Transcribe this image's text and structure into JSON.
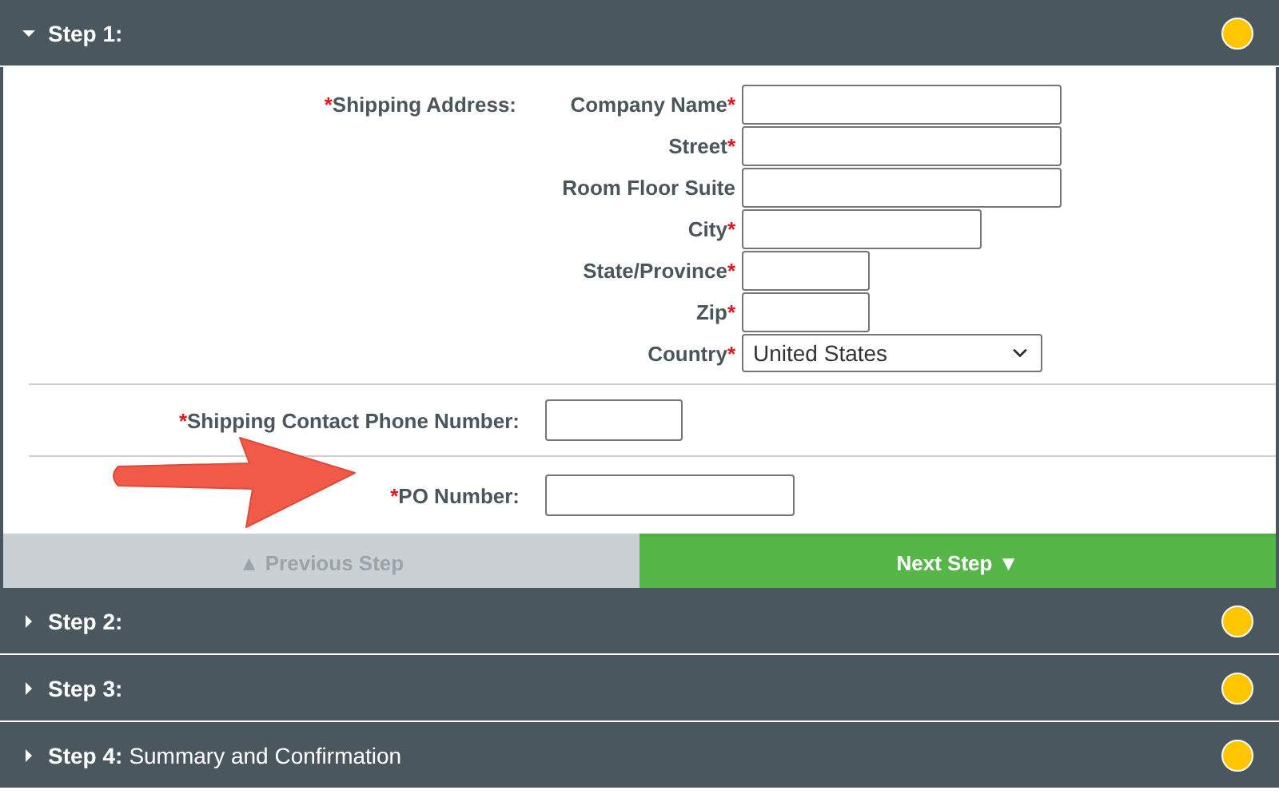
{
  "steps": [
    {
      "title": "Step 1:",
      "expanded": true,
      "color": "#ffc600"
    },
    {
      "title": "Step 2:",
      "expanded": false,
      "color": "#ffc600"
    },
    {
      "title": "Step 3:",
      "expanded": false,
      "color": "#ffc600"
    },
    {
      "title": "Step 4:",
      "subtitle": "Summary and Confirmation",
      "expanded": false,
      "color": "#ffc600"
    }
  ],
  "shipping_address": {
    "label": "Shipping Address:",
    "required": "*",
    "fields": [
      {
        "label": "Company Name",
        "required": "*",
        "kind": "long"
      },
      {
        "label": "Street",
        "required": "*",
        "kind": "long"
      },
      {
        "label": "Room Floor Suite",
        "kind": "long"
      },
      {
        "label": "City",
        "required": "*",
        "kind": "medium"
      },
      {
        "label": "State/Province",
        "required": "*",
        "kind": "short"
      },
      {
        "label": "Zip",
        "required": "*",
        "kind": "short"
      },
      {
        "label": "Country",
        "required": "*",
        "kind": "select",
        "value": "United States"
      }
    ]
  },
  "phone": {
    "label": "Shipping Contact Phone Number:",
    "required": "*"
  },
  "po_number": {
    "label": "PO Number:",
    "required": "*",
    "annotation_arrow": true
  },
  "buttons": [
    {
      "label": "▲ Previous Step",
      "disabled": true
    },
    {
      "label": "Next Step ▼",
      "disabled": false
    }
  ]
}
